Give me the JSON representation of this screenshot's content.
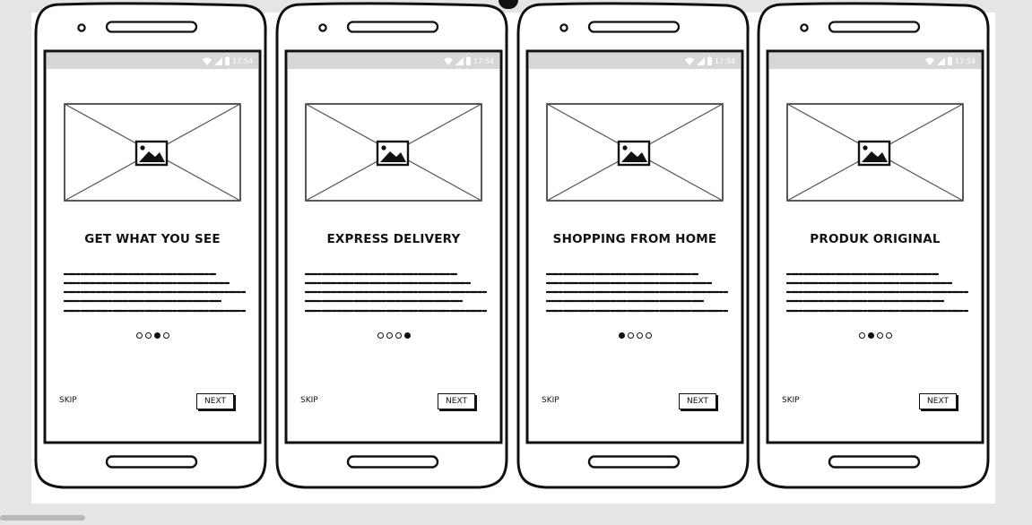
{
  "status_time": "17:54",
  "skip_label": "SKIP",
  "next_label": "NEXT",
  "icons": [
    "camera-hole",
    "speaker-slot",
    "home-slot",
    "wifi-icon",
    "signal-icon",
    "battery-icon",
    "image-icon"
  ],
  "screens": [
    {
      "title": "GET WHAT YOU SEE",
      "active_dot": 2,
      "dots_total": 4
    },
    {
      "title": "EXPRESS DELIVERY",
      "active_dot": 3,
      "dots_total": 4
    },
    {
      "title": "SHOPPING FROM HOME",
      "active_dot": 0,
      "dots_total": 4
    },
    {
      "title": "PRODUK ORIGINAL",
      "active_dot": 1,
      "dots_total": 4
    }
  ]
}
